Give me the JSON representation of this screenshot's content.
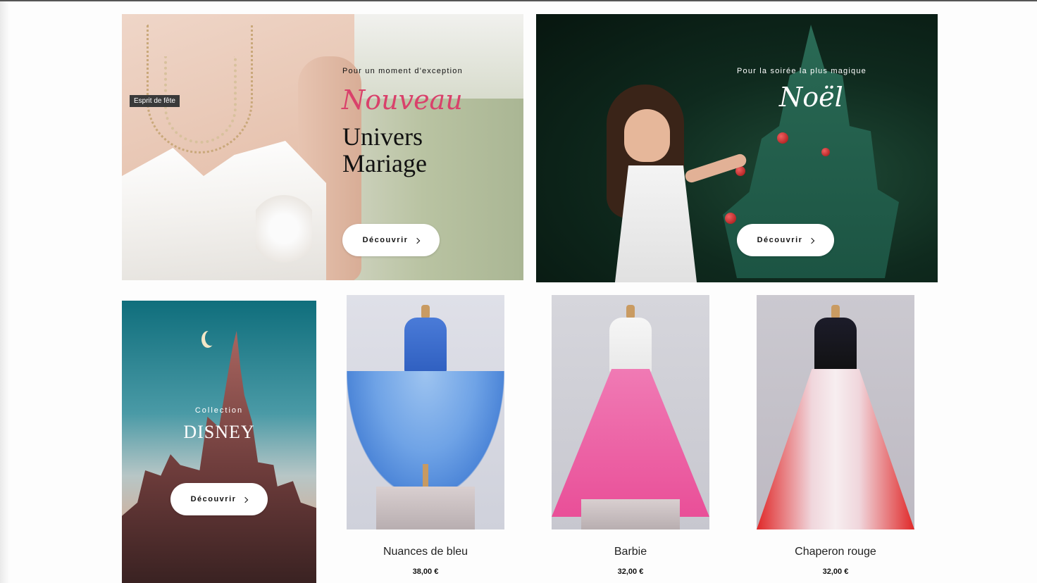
{
  "banners": {
    "wedding": {
      "tag": "Esprit de fête",
      "kicker": "Pour un moment d'exception",
      "script": "Nouveau",
      "title_line1": "Univers",
      "title_line2": "Mariage",
      "button": "Découvrir"
    },
    "noel": {
      "kicker": "Pour la soirée la plus magique",
      "script": "Noël",
      "button": "Découvrir"
    },
    "disney": {
      "kicker": "Collection",
      "title": "DISNEY",
      "button": "Découvrir"
    }
  },
  "products": [
    {
      "name": "Nuances de bleu",
      "price": "38,00 €"
    },
    {
      "name": "Barbie",
      "price": "32,00 €"
    },
    {
      "name": "Chaperon rouge",
      "price": "32,00 €"
    }
  ],
  "colors": {
    "accent_pink": "#d9416b",
    "button_bg": "#ffffff"
  },
  "icons": [
    "chevron-right-icon"
  ]
}
